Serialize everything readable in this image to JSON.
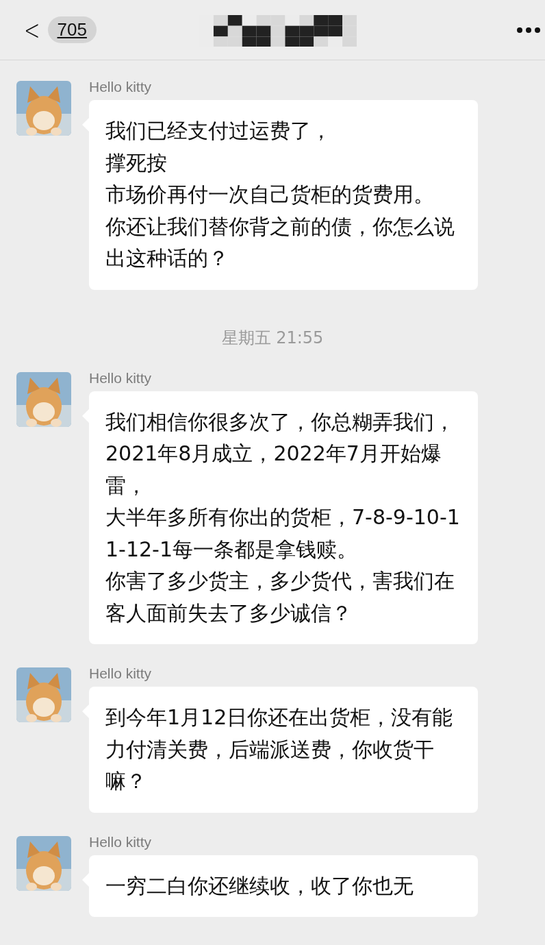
{
  "header": {
    "back_icon": "<",
    "unread_count": "705"
  },
  "messages": [
    {
      "kind": "message",
      "sender": "Hello kitty",
      "lines": [
        "我们已经支付过运费了，",
        "撑死按",
        "市场价再付一次自己货柜的货费用。",
        "你还让我们替你背之前的债，你怎么说出这种话的？"
      ]
    },
    {
      "kind": "time",
      "text": "星期五 21:55"
    },
    {
      "kind": "message",
      "sender": "Hello kitty",
      "lines": [
        "我们相信你很多次了，你总糊弄我们，",
        "2021年8月成立，2022年7月开始爆雷，",
        "大半年多所有你出的货柜，7-8-9-10-11-12-1每一条都是拿钱赎。",
        "你害了多少货主，多少货代，害我们在客人面前失去了多少诚信？"
      ]
    },
    {
      "kind": "message",
      "sender": "Hello kitty",
      "lines": [
        "到今年1月12日你还在出货柜，没有能力付清关费，后端派送费，你收货干嘛？"
      ]
    },
    {
      "kind": "message",
      "sender": "Hello kitty",
      "lines": [
        "一穷二白你还继续收，收了你也无"
      ]
    }
  ]
}
